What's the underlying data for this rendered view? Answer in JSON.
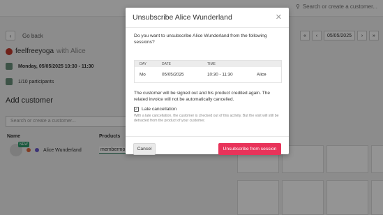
{
  "header": {
    "search_placeholder": "Search or create a customer..."
  },
  "page": {
    "back_label": "Go back",
    "event_name": "feelfreeyoga",
    "event_with": "with Alice",
    "date_line": "Monday, 05/05/2025 10:30 - 11:30",
    "participants": "1/10 participants",
    "add_customer": "Add customer",
    "customer_search_placeholder": "Search or create a customer...",
    "columns": {
      "name": "Name",
      "products": "Products"
    },
    "customer": {
      "name": "Alice Wunderland",
      "badge": "NEW",
      "product": "membermo"
    },
    "nav_date": "05/05/2025"
  },
  "modal": {
    "title": "Unsubscribe Alice Wunderland",
    "question": "Do you want to unsubscribe Alice Wunderland from the following sessions?",
    "table_headers": {
      "day": "DAY",
      "date": "DATE",
      "time": "TIME"
    },
    "rows": [
      {
        "day": "Mo",
        "date": "05/05/2025",
        "time": "10:30 - 11:30",
        "teacher": "Alice"
      }
    ],
    "note": "The customer will be signed out and his product credited again. The related invoice will not be automatically cancelled.",
    "late_label": "Late cancellation",
    "late_help": "With a late cancellation, the customer is checked out of this activity. But the visit will still be detracted from the product of your customer.",
    "cancel_label": "Cancel",
    "confirm_label": "Unsubscribe from session"
  },
  "colors": {
    "accent": "#e8335a",
    "overlay": "rgba(0,0,0,0.42)"
  }
}
